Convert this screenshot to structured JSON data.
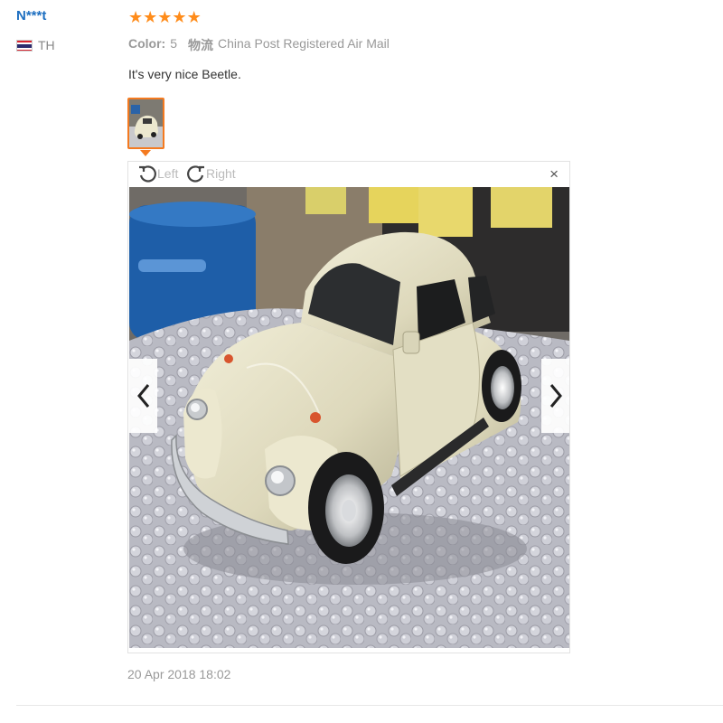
{
  "reviewer": {
    "name": "N***t",
    "country_code": "TH",
    "flag_icon": "thailand-flag-icon"
  },
  "review": {
    "rating": 5,
    "rating_max": 5,
    "attributes": [
      {
        "key": "Color:",
        "value": "5"
      },
      {
        "key": "物流",
        "value": "China Post Registered Air Mail"
      }
    ],
    "text": "It's very nice Beetle.",
    "date": "20 Apr 2018 18:02"
  },
  "viewer": {
    "rotate_left_label": "Left",
    "rotate_right_label": "Right",
    "close_label": "×",
    "image_alt": "photo of a cream coloured toy Beetle car on bubble wrap"
  },
  "colors": {
    "accent": "#f47a20",
    "star": "#ff8c1a",
    "username": "#1c6ec0"
  }
}
